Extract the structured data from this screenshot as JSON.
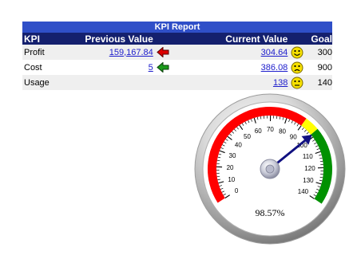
{
  "table": {
    "title": "KPI Report",
    "headers": {
      "kpi": "KPI",
      "previous": "Previous Value",
      "current": "Current Value",
      "goal": "Goal"
    },
    "rows": [
      {
        "kpi": "Profit",
        "previous": "159,167.84",
        "previous_trend": "down",
        "current": "304.64",
        "current_status": "happy",
        "goal": "300"
      },
      {
        "kpi": "Cost",
        "previous": "5",
        "previous_trend": "up",
        "current": "386.08",
        "current_status": "sad",
        "goal": "900"
      },
      {
        "kpi": "Usage",
        "previous": "",
        "previous_trend": "",
        "current": "138",
        "current_status": "neutral",
        "goal": "140"
      }
    ]
  },
  "gauge": {
    "readout": "98.57%",
    "min": 0,
    "max": 140,
    "value": 98.57,
    "ticks": [
      "0",
      "10",
      "20",
      "30",
      "40",
      "50",
      "60",
      "70",
      "80",
      "90",
      "100",
      "110",
      "120",
      "130",
      "140"
    ],
    "bands": [
      {
        "from": 0,
        "to": 90,
        "color": "#ff0000"
      },
      {
        "from": 90,
        "to": 98,
        "color": "#ffff00"
      },
      {
        "from": 98,
        "to": 140,
        "color": "#009100"
      }
    ],
    "needle_color": "#101080"
  },
  "colors": {
    "title_bar": "#2f4fc8",
    "header_bar": "#14206e",
    "link": "#1c1ccc",
    "trend_down": "#dd0000",
    "trend_up": "#1a9a1a"
  },
  "icons": {
    "trend_down": "red-arrow-left-icon",
    "trend_up": "green-arrow-left-icon",
    "happy": "happy-smiley-icon",
    "sad": "sad-smiley-icon",
    "neutral": "neutral-smiley-icon"
  }
}
